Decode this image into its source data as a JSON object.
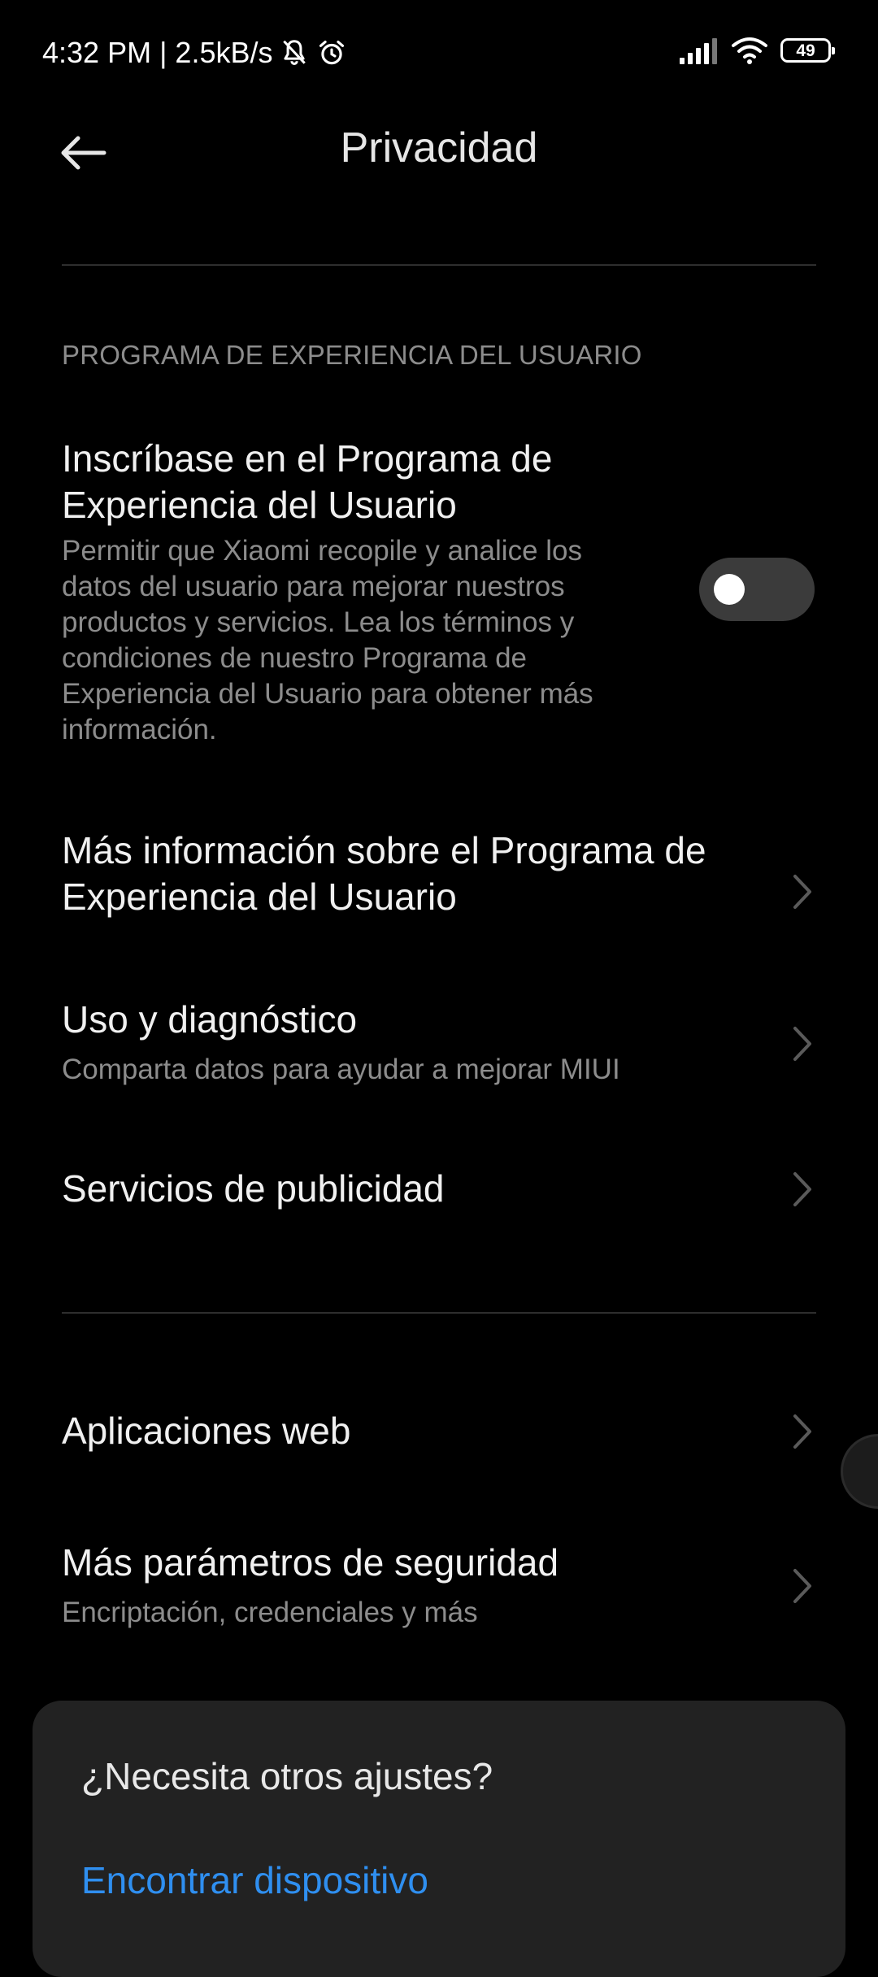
{
  "status_bar": {
    "time_speed": "4:32 PM | 2.5kB/s",
    "icons": [
      "bell-muted-icon",
      "alarm-icon",
      "signal-icon",
      "wifi-icon",
      "battery-icon"
    ],
    "battery_level": "49"
  },
  "header": {
    "title": "Privacidad",
    "back_icon": "arrow-left-icon"
  },
  "section": {
    "header": "PROGRAMA DE EXPERIENCIA DEL USUARIO"
  },
  "items": {
    "enroll": {
      "title": "Inscríbase en el Programa de Experiencia del Usuario",
      "subtitle": "Permitir que Xiaomi recopile y analice los datos del usuario para mejorar nuestros productos y servicios. Lea los términos y condiciones de nuestro Programa de Experiencia del Usuario para obtener más información.",
      "toggle_on": false
    },
    "more_info": {
      "title": "Más información sobre el Programa de Experiencia del Usuario"
    },
    "usage": {
      "title": "Uso y diagnóstico",
      "subtitle": "Comparta datos para ayudar a mejorar MIUI"
    },
    "ads": {
      "title": "Servicios de publicidad"
    },
    "web_apps": {
      "title": "Aplicaciones web"
    },
    "security": {
      "title": "Más parámetros de seguridad",
      "subtitle": "Encriptación, credenciales y más"
    }
  },
  "card": {
    "title": "¿Necesita otros ajustes?",
    "link": "Encontrar dispositivo"
  },
  "colors": {
    "background": "#000000",
    "card": "#222222",
    "link": "#2f8ff0",
    "secondary_text": "#8c8c8c"
  }
}
